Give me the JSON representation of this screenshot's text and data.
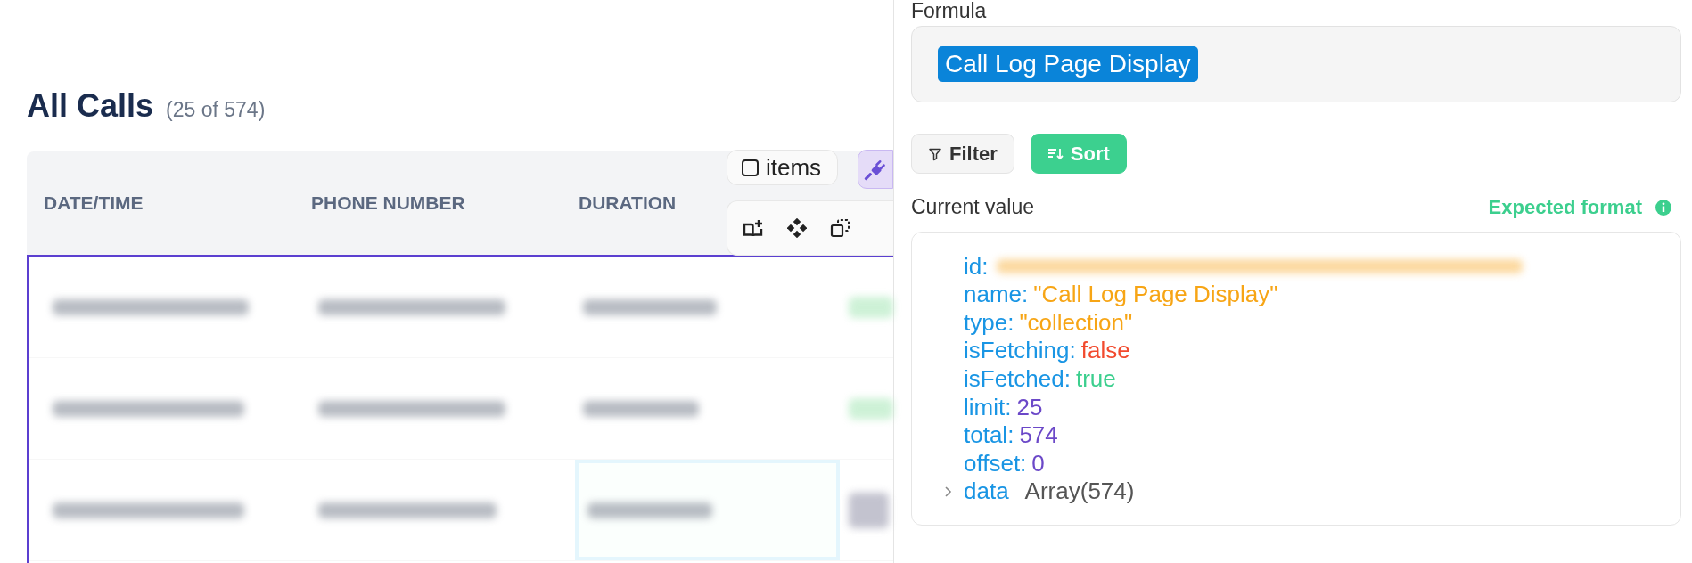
{
  "page": {
    "title": "All Calls",
    "count": "(25 of 574)"
  },
  "table": {
    "columns": [
      "DATE/TIME",
      "PHONE NUMBER",
      "DURATION"
    ],
    "rows": [
      {
        "redacted": true,
        "status": true
      },
      {
        "redacted": true,
        "status": true
      },
      {
        "redacted": true,
        "status": false,
        "highlighted_cell": true
      }
    ]
  },
  "component_toolbar": {
    "chip": "items",
    "plugin_active": true
  },
  "panel": {
    "formula_label": "Formula",
    "formula": "Call Log Page Display",
    "buttons": [
      {
        "label": "Filter",
        "selected": false,
        "kind": "filter"
      },
      {
        "label": "Sort",
        "selected": true,
        "kind": "sort"
      }
    ],
    "current_value_label": "Current value",
    "expected_format": "Expected format",
    "lines": [
      {
        "key": "id:",
        "kind": "redacted"
      },
      {
        "key": "name:",
        "value": "\"Call Log Page Display\"",
        "kind": "string"
      },
      {
        "key": "type:",
        "value": "\"collection\"",
        "kind": "string"
      },
      {
        "key": "isFetching:",
        "value": "false",
        "kind": "boolean",
        "color": "#f24a2e"
      },
      {
        "key": "isFetched:",
        "value": "true",
        "kind": "boolean",
        "color": "#3ccf8e"
      },
      {
        "key": "limit:",
        "value": "25",
        "kind": "number"
      },
      {
        "key": "total:",
        "value": "574",
        "kind": "number"
      },
      {
        "key": "offset:",
        "value": "0",
        "kind": "number"
      },
      {
        "key": "data",
        "value": "Array(574)",
        "kind": "array",
        "expanded": false
      }
    ]
  }
}
